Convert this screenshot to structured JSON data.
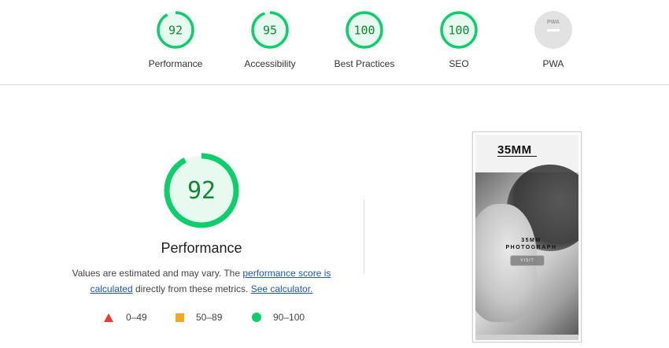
{
  "gauges": [
    {
      "score": "92",
      "label": "Performance",
      "fraction": 0.92,
      "color": "#0cce6b"
    },
    {
      "score": "95",
      "label": "Accessibility",
      "fraction": 0.95,
      "color": "#0cce6b"
    },
    {
      "score": "100",
      "label": "Best Practices",
      "fraction": 1.0,
      "color": "#0cce6b"
    },
    {
      "score": "100",
      "label": "SEO",
      "fraction": 1.0,
      "color": "#0cce6b"
    },
    {
      "score": "PWA",
      "label": "PWA",
      "fraction": 0,
      "color": "#cccccc"
    }
  ],
  "main": {
    "score": "92",
    "score_fraction": 0.92,
    "title": "Performance",
    "desc_prefix": "Values are estimated and may vary. The ",
    "desc_link1": "performance score is calculated",
    "desc_middle": " directly from these metrics. ",
    "desc_link2": "See calculator."
  },
  "legend": {
    "fail": "0–49",
    "average": "50–89",
    "pass": "90–100"
  },
  "colors": {
    "pass": "#0cce6b",
    "pass_text": "#0c8a30",
    "average": "#f5a623",
    "fail": "#eb3b2b",
    "link": "#1a55c7"
  },
  "screenshot": {
    "logo": "35MM",
    "hero_line1": "35MM",
    "hero_line2": "PHOTOGRAPH",
    "button": "VISIT"
  }
}
